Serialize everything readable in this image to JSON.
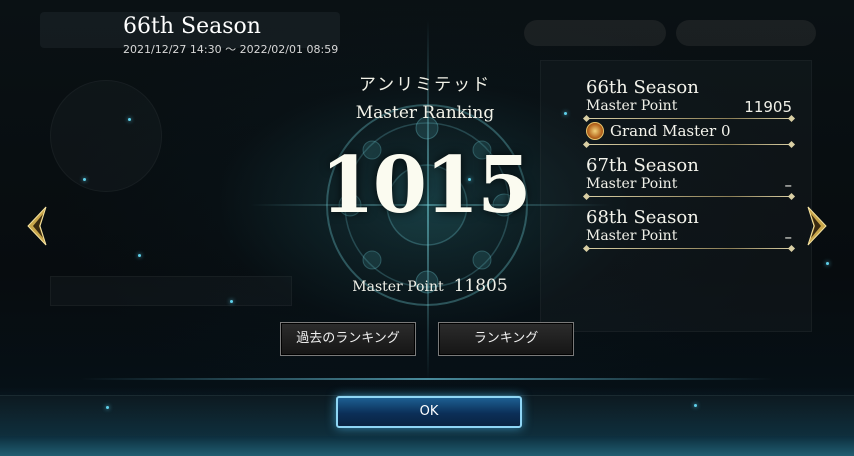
{
  "header": {
    "season_title": "66th Season",
    "season_dates": "2021/12/27 14:30 〜 2022/02/01 08:59"
  },
  "center": {
    "mode": "アンリミテッド",
    "ranking_label": "Master Ranking",
    "rank": "1015",
    "master_point_label": "Master Point",
    "master_point_value": "11805"
  },
  "seasons": [
    {
      "title": "66th Season",
      "master_point_label": "Master Point",
      "master_point_value": "11905",
      "rank_title": "Grand Master 0"
    },
    {
      "title": "67th Season",
      "master_point_label": "Master Point",
      "master_point_value": "–"
    },
    {
      "title": "68th Season",
      "master_point_label": "Master Point",
      "master_point_value": "–"
    }
  ],
  "buttons": {
    "past_ranking": "過去のランキング",
    "ranking": "ランキング",
    "ok": "OK"
  },
  "colors": {
    "accent_glow": "#5fd0ea",
    "ok_button": "#1d5f92",
    "gold_rule": "#d9cfa4"
  },
  "icons": {
    "left": "chevron-left-icon",
    "right": "chevron-right-icon",
    "rank": "grand-master-emblem-icon"
  }
}
